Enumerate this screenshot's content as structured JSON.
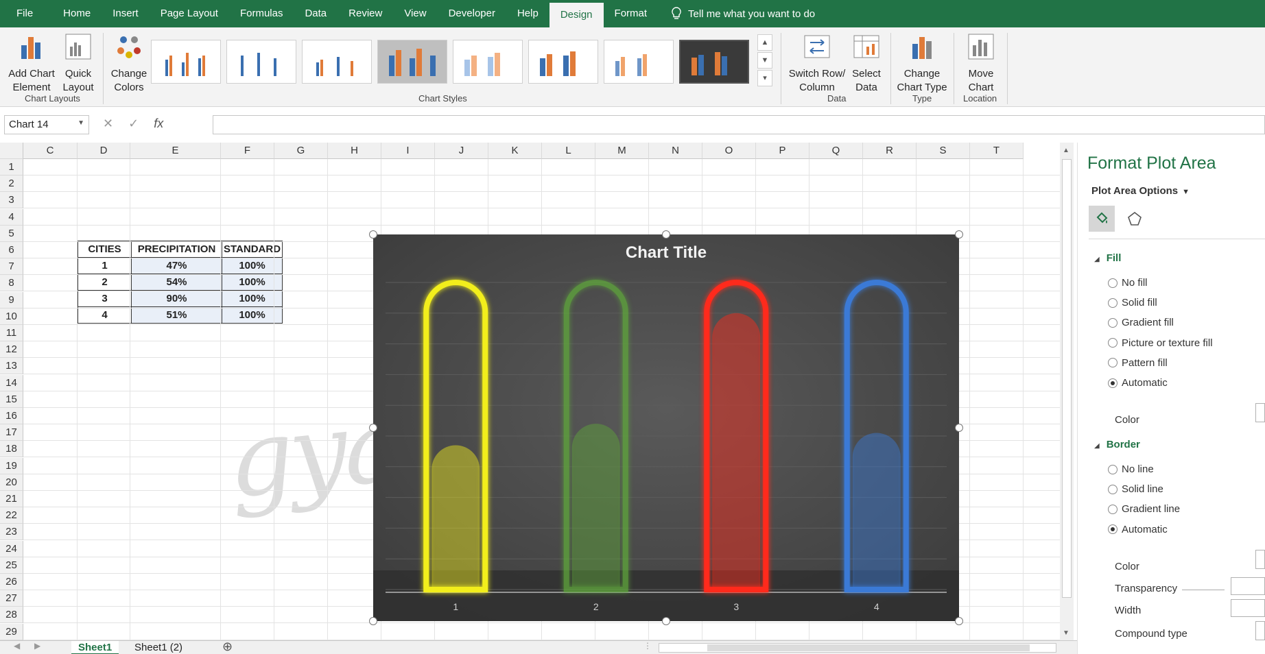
{
  "tabs": [
    "File",
    "Home",
    "Insert",
    "Page Layout",
    "Formulas",
    "Data",
    "Review",
    "View",
    "Developer",
    "Help",
    "Design",
    "Format"
  ],
  "active_tab": "Design",
  "tell_me": "Tell me what you want to do",
  "ribbon": {
    "add_chart_element": "Add Chart Element",
    "quick_layout": "Quick Layout",
    "change_colors": "Change Colors",
    "switch_row_column": "Switch Row/ Column",
    "select_data": "Select Data",
    "change_chart_type": "Change Chart Type",
    "move_chart": "Move Chart",
    "groups": {
      "chart_layouts": "Chart Layouts",
      "chart_styles": "Chart Styles",
      "data": "Data",
      "type": "Type",
      "location": "Location"
    }
  },
  "name_box": "Chart 14",
  "formula_icons": {
    "cancel": "✕",
    "enter": "✓",
    "fx": "fx"
  },
  "columns": [
    "C",
    "D",
    "E",
    "F",
    "G",
    "H",
    "I",
    "J",
    "K",
    "L",
    "M",
    "N",
    "O",
    "P",
    "Q",
    "R",
    "S",
    "T"
  ],
  "rows": [
    "1",
    "2",
    "3",
    "4",
    "5",
    "6",
    "7",
    "8",
    "9",
    "10",
    "11",
    "12",
    "13",
    "14",
    "15",
    "16",
    "17",
    "18",
    "19",
    "20",
    "21",
    "22",
    "23",
    "24",
    "25",
    "26",
    "27",
    "28",
    "29"
  ],
  "table": {
    "headers": [
      "CITIES",
      "PRECIPITATION",
      "STANDARD"
    ],
    "rows": [
      [
        "1",
        "47%",
        "100%"
      ],
      [
        "2",
        "54%",
        "100%"
      ],
      [
        "3",
        "90%",
        "100%"
      ],
      [
        "4",
        "51%",
        "100%"
      ]
    ]
  },
  "watermark": "gyankosh.net",
  "chart_data": {
    "type": "bar",
    "title": "Chart Title",
    "categories": [
      "1",
      "2",
      "3",
      "4"
    ],
    "series": [
      {
        "name": "PRECIPITATION",
        "values": [
          47,
          54,
          90,
          51
        ]
      },
      {
        "name": "STANDARD",
        "values": [
          100,
          100,
          100,
          100
        ]
      }
    ],
    "ylim": [
      0,
      100
    ],
    "colors": [
      "#f2ee1c",
      "#5fa83a",
      "#ff2a1a",
      "#3a7ad6"
    ],
    "background": "#3c3c3c"
  },
  "pane": {
    "title": "Format Plot Area",
    "subtitle": "Plot Area Options",
    "fill_section": "Fill",
    "fill_options": [
      "No fill",
      "Solid fill",
      "Gradient fill",
      "Picture or texture fill",
      "Pattern fill",
      "Automatic"
    ],
    "fill_selected": "Automatic",
    "color_label": "Color",
    "border_section": "Border",
    "border_options": [
      "No line",
      "Solid line",
      "Gradient line",
      "Automatic"
    ],
    "border_selected": "Automatic",
    "border_color_label": "Color",
    "transparency_label": "Transparency",
    "width_label": "Width",
    "compound_label": "Compound type"
  },
  "sheets": [
    "Sheet1",
    "Sheet1 (2)"
  ],
  "active_sheet": "Sheet1"
}
